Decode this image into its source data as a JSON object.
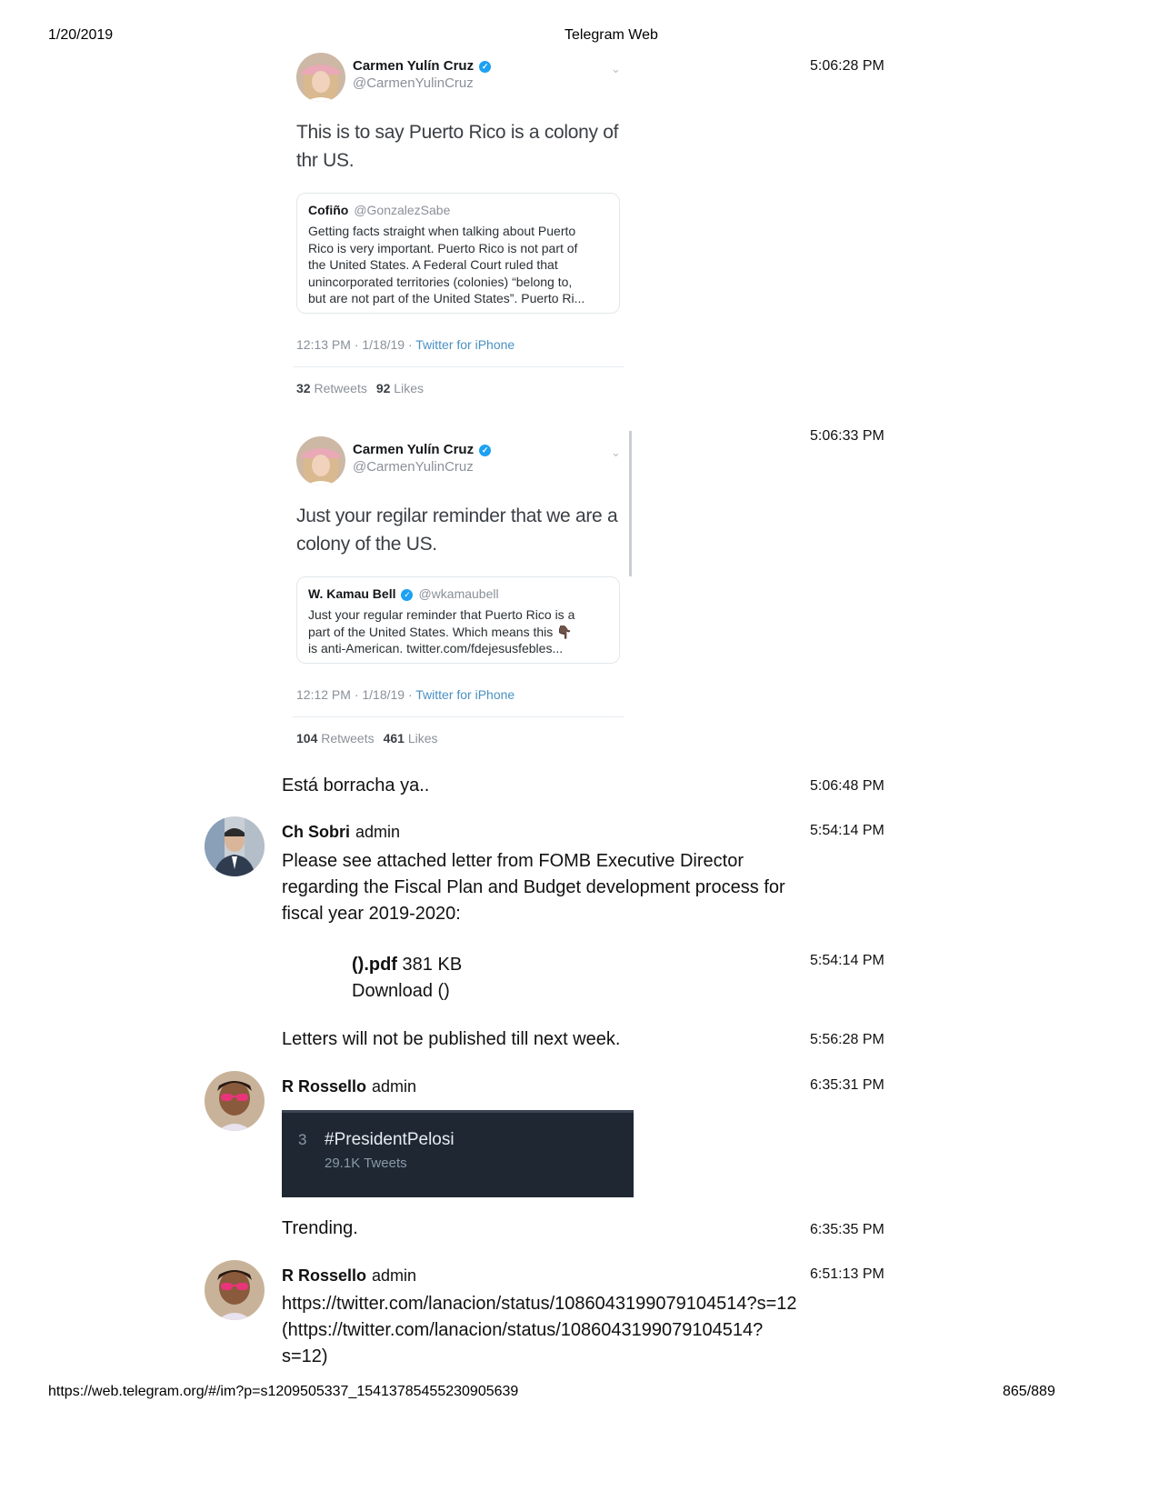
{
  "print": {
    "date": "1/20/2019",
    "title": "Telegram Web",
    "url": "https://web.telegram.org/#/im?p=s1209505337_15413785455230905639",
    "page": "865/889"
  },
  "tweet1": {
    "name": "Carmen Yulín Cruz",
    "handle": "@CarmenYulinCruz",
    "body_line1": "This is to say Puerto Rico is a colony of",
    "body_line2": "thr US.",
    "quote_name": "Cofiño",
    "quote_handle": "@GonzalezSabe",
    "quote_lines": [
      "Getting facts straight when talking about Puerto",
      "Rico is very important. Puerto Rico is not part of",
      "the United States. A Federal Court ruled that",
      "unincorporated territories (colonies) “belong to,",
      "but are not part of the United States”. Puerto Ri..."
    ],
    "meta": "12:13 PM · 1/18/19 · ",
    "source": "Twitter for iPhone",
    "retweets": "32",
    "retweets_label": "Retweets",
    "likes": "92",
    "likes_label": "Likes",
    "time": "5:06:28 PM"
  },
  "tweet2": {
    "name": "Carmen Yulín Cruz",
    "handle": "@CarmenYulinCruz",
    "body_line1": "Just your regilar reminder that we are a",
    "body_line2": "colony of the US.",
    "quote_name": "W. Kamau Bell",
    "quote_handle": "@wkamaubell",
    "quote_lines": [
      "Just your regular reminder that Puerto Rico is a",
      "part of the United States. Which means this 👇🏿",
      "is anti-American. twitter.com/fdejesusfebles..."
    ],
    "meta": "12:12 PM · 1/18/19 · ",
    "source": "Twitter for iPhone",
    "retweets": "104",
    "retweets_label": "Retweets",
    "likes": "461",
    "likes_label": "Likes",
    "time": "5:06:33 PM"
  },
  "messages": {
    "m1": {
      "text": "Está borracha ya..",
      "time": "5:06:48 PM"
    },
    "m2": {
      "sender": "Ch Sobri",
      "role": "admin",
      "time": "5:54:14 PM",
      "lines": [
        "Please see attached letter from FOMB Executive Director",
        "regarding the Fiscal Plan and Budget development process for",
        "fiscal year 2019-2020:"
      ]
    },
    "m3": {
      "file_name": "().pdf",
      "file_size": "381 KB",
      "download": "Download ()",
      "time": "5:54:14 PM"
    },
    "m4": {
      "text": "Letters will not be published till next week.",
      "time": "5:56:28 PM"
    },
    "m5": {
      "sender": "R Rossello",
      "role": "admin",
      "time": "6:35:31 PM",
      "trend_rank": "3",
      "trend_tag": "#PresidentPelosi",
      "trend_count": "29.1K Tweets"
    },
    "m6": {
      "text": "Trending.",
      "time": "6:35:35 PM"
    },
    "m7": {
      "sender": "R Rossello",
      "role": "admin",
      "time": "6:51:13 PM",
      "lines": [
        "https://twitter.com/lanacion/status/1086043199079104514?s=12",
        "(https://twitter.com/lanacion/status/1086043199079104514?",
        "s=12)"
      ]
    }
  },
  "colors": {
    "twitter_blue": "#1da1f2",
    "trend_bg": "#1f2733"
  }
}
